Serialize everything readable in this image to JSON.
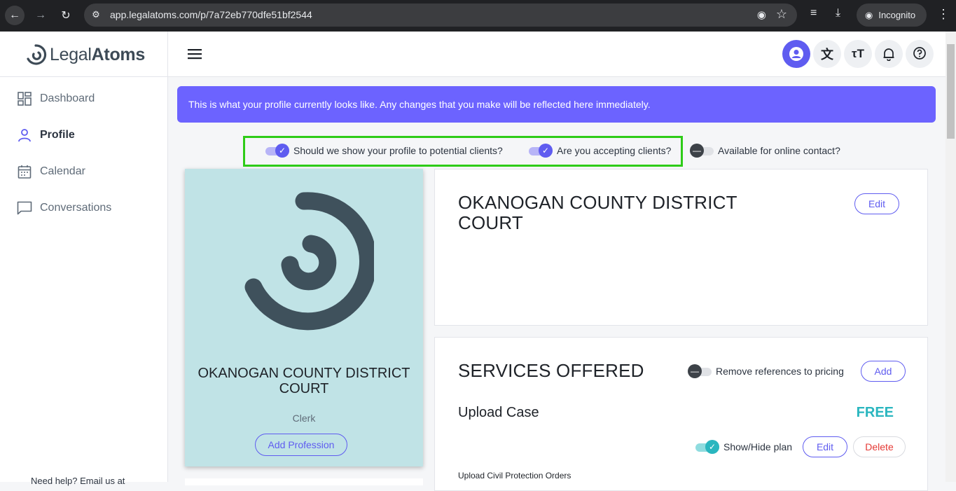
{
  "browser": {
    "url": "app.legalatoms.com/p/7a72eb770dfe51bf2544",
    "incognito_label": "Incognito"
  },
  "logo": {
    "text_light": "Legal",
    "text_bold": "Atoms"
  },
  "sidebar": {
    "items": [
      {
        "label": "Dashboard",
        "icon": "dashboard-icon"
      },
      {
        "label": "Profile",
        "icon": "person-icon",
        "active": true
      },
      {
        "label": "Calendar",
        "icon": "calendar-icon"
      },
      {
        "label": "Conversations",
        "icon": "chat-icon"
      }
    ],
    "help_text": "Need help? Email us at"
  },
  "banner": {
    "text": "This is what your profile currently looks like. Any changes that you make will be reflected here immediately."
  },
  "toggles": {
    "show_profile": {
      "label": "Should we show your profile to potential clients?",
      "on": true
    },
    "accepting_clients": {
      "label": "Are you accepting clients?",
      "on": true
    },
    "online_contact": {
      "label": "Available for online contact?",
      "on": false
    }
  },
  "profile_card": {
    "name": "OKANOGAN COUNTY DISTRICT COURT",
    "role": "Clerk",
    "add_profession_label": "Add Profession"
  },
  "about_panel": {
    "heading": "OKANOGAN COUNTY DISTRICT COURT",
    "edit_label": "Edit"
  },
  "services": {
    "heading": "SERVICES OFFERED",
    "remove_pricing_label": "Remove references to pricing",
    "remove_pricing_on": false,
    "add_label": "Add",
    "items": [
      {
        "title": "Upload Case",
        "price": "FREE",
        "show_hide_label": "Show/Hide plan",
        "show_hide_on": true,
        "edit_label": "Edit",
        "delete_label": "Delete",
        "description": "Upload Civil Protection Orders"
      }
    ]
  },
  "colors": {
    "accent": "#5f5cf0",
    "banner": "#6c63ff",
    "highlight": "#2ecc18",
    "price": "#2ab6bf",
    "card": "#c0e3e6"
  }
}
